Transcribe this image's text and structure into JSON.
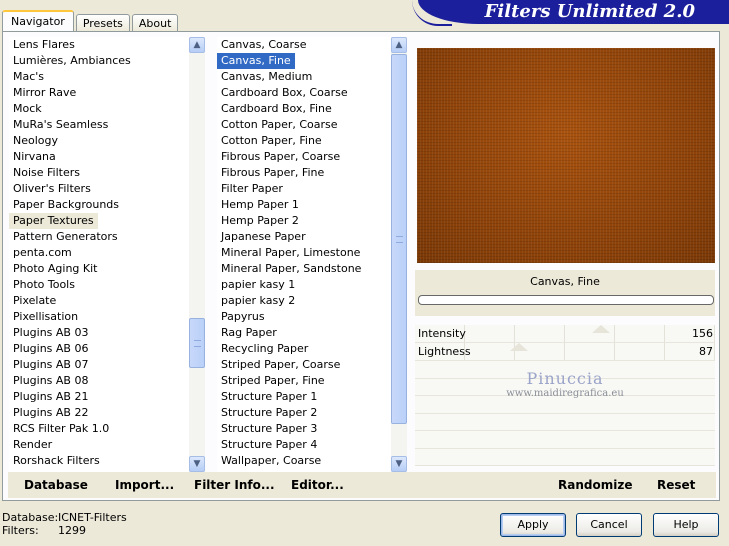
{
  "tabs": [
    {
      "label": "Navigator"
    },
    {
      "label": "Presets"
    },
    {
      "label": "About"
    }
  ],
  "banner": {
    "title": "Filters Unlimited 2.0"
  },
  "categories": {
    "items": [
      "Lens Flares",
      "Lumières, Ambiances",
      "Mac's",
      "Mirror Rave",
      "Mock",
      "MuRa's Seamless",
      "Neology",
      "Nirvana",
      "Noise Filters",
      "Oliver's Filters",
      "Paper Backgrounds",
      "Paper Textures",
      "Pattern Generators",
      "penta.com",
      "Photo Aging Kit",
      "Photo Tools",
      "Pixelate",
      "Pixellisation",
      "Plugins AB 03",
      "Plugins AB 06",
      "Plugins AB 07",
      "Plugins AB 08",
      "Plugins AB 21",
      "Plugins AB 22",
      "RCS Filter Pak 1.0",
      "Render",
      "Rorshack Filters"
    ],
    "selected": "Paper Textures"
  },
  "filters": {
    "items": [
      "Canvas, Coarse",
      "Canvas, Fine",
      "Canvas, Medium",
      "Cardboard Box, Coarse",
      "Cardboard Box, Fine",
      "Cotton Paper, Coarse",
      "Cotton Paper, Fine",
      "Fibrous Paper, Coarse",
      "Fibrous Paper, Fine",
      "Filter Paper",
      "Hemp Paper 1",
      "Hemp Paper 2",
      "Japanese Paper",
      "Mineral Paper, Limestone",
      "Mineral Paper, Sandstone",
      "papier kasy 1",
      "papier kasy 2",
      "Papyrus",
      "Rag Paper",
      "Recycling Paper",
      "Striped Paper, Coarse",
      "Striped Paper, Fine",
      "Structure Paper 1",
      "Structure Paper 2",
      "Structure Paper 3",
      "Structure Paper 4",
      "Wallpaper, Coarse"
    ],
    "selected": "Canvas, Fine"
  },
  "preview": {
    "filter_name": "Canvas, Fine",
    "texture_color": "#924509"
  },
  "sliders": [
    {
      "label": "Intensity",
      "value": "156"
    },
    {
      "label": "Lightness",
      "value": "87"
    }
  ],
  "watermark": {
    "name": "Pinuccia",
    "url": "www.maidiregrafica.eu"
  },
  "toolbar": {
    "database": "Database",
    "import": "Import...",
    "filter_info": "Filter Info...",
    "editor": "Editor...",
    "randomize": "Randomize",
    "reset": "Reset"
  },
  "footer": {
    "database_label": "Database:",
    "database_value": "ICNET-Filters",
    "filters_label": "Filters:",
    "filters_value": "1299"
  },
  "buttons": {
    "apply": "Apply",
    "cancel": "Cancel",
    "help": "Help"
  },
  "colors": {
    "selection": "#316ac5",
    "banner": "#1c1f9c",
    "tab_highlight": "#ffc83c"
  }
}
